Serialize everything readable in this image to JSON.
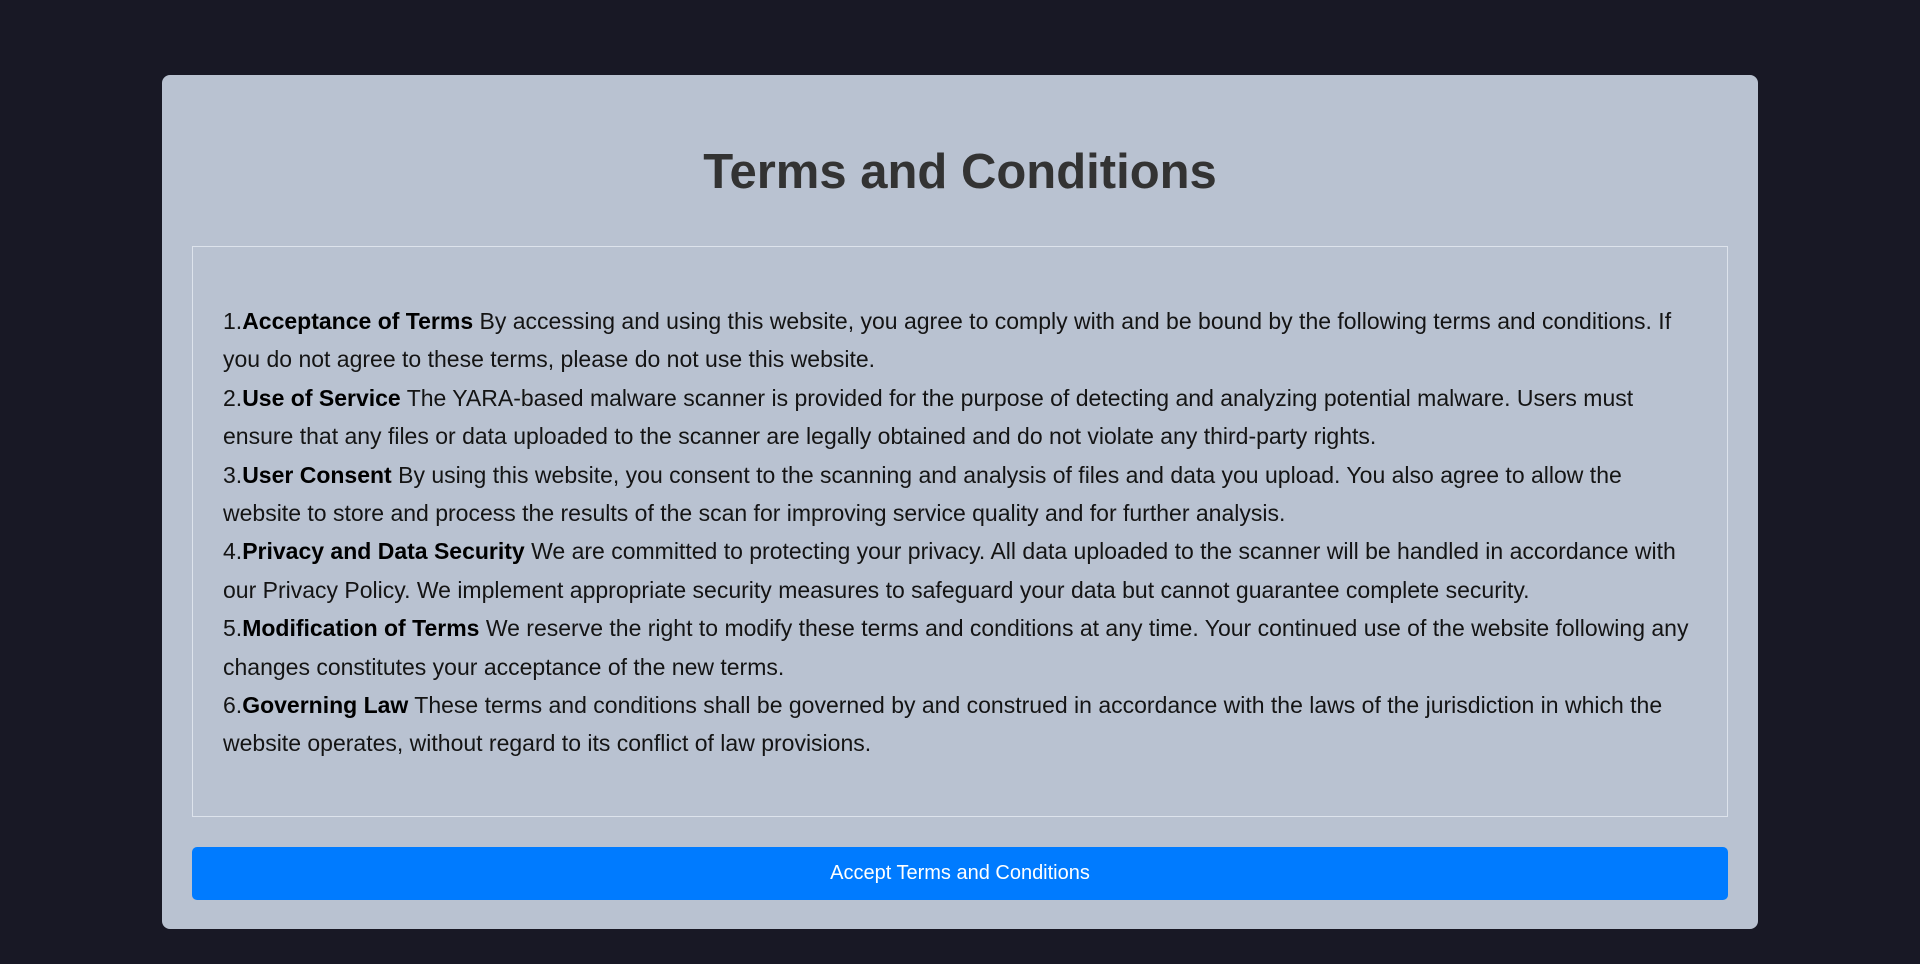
{
  "page": {
    "title": "Terms and Conditions",
    "colors": {
      "background": "#181825",
      "card": "#b9c2d1",
      "button": "#007bff"
    }
  },
  "terms": [
    {
      "number": "1.",
      "heading": "Acceptance of Terms",
      "text": " By accessing and using this website, you agree to comply with and be bound by the following terms and conditions. If you do not agree to these terms, please do not use this website."
    },
    {
      "number": "2.",
      "heading": "Use of Service",
      "text": " The YARA-based malware scanner is provided for the purpose of detecting and analyzing potential malware. Users must ensure that any files or data uploaded to the scanner are legally obtained and do not violate any third-party rights."
    },
    {
      "number": "3.",
      "heading": "User Consent",
      "text": " By using this website, you consent to the scanning and analysis of files and data you upload. You also agree to allow the website to store and process the results of the scan for improving service quality and for further analysis."
    },
    {
      "number": "4.",
      "heading": "Privacy and Data Security",
      "text": " We are committed to protecting your privacy. All data uploaded to the scanner will be handled in accordance with our Privacy Policy. We implement appropriate security measures to safeguard your data but cannot guarantee complete security."
    },
    {
      "number": "5.",
      "heading": "Modification of Terms",
      "text": " We reserve the right to modify these terms and conditions at any time. Your continued use of the website following any changes constitutes your acceptance of the new terms."
    },
    {
      "number": "6.",
      "heading": "Governing Law",
      "text": " These terms and conditions shall be governed by and construed in accordance with the laws of the jurisdiction in which the website operates, without regard to its conflict of law provisions."
    }
  ],
  "accept_button": {
    "label": "Accept Terms and Conditions"
  }
}
